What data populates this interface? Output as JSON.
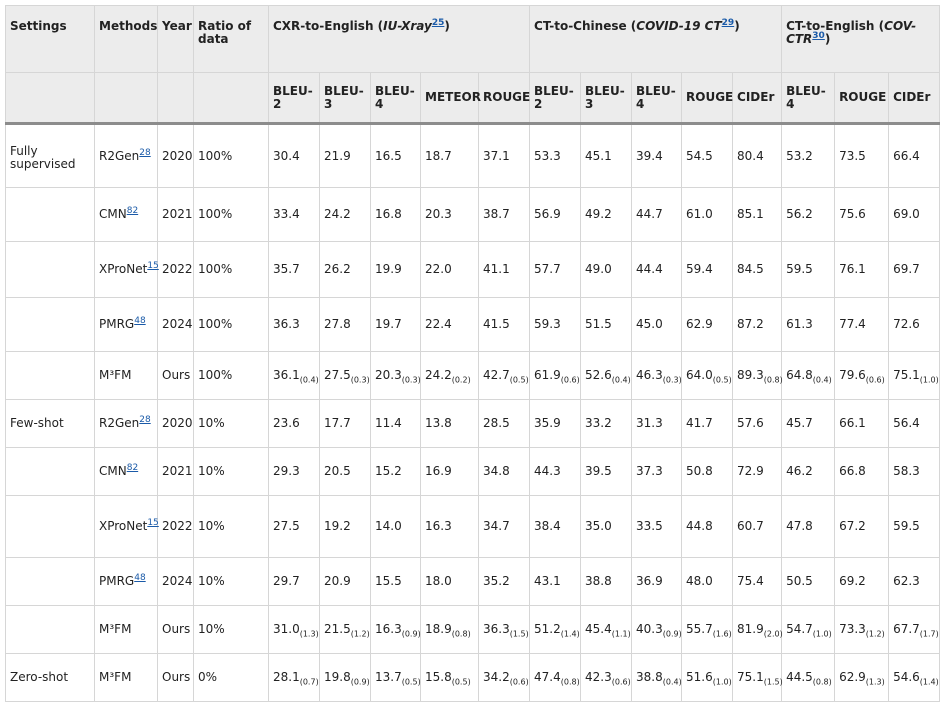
{
  "header": {
    "settings": "Settings",
    "methods": "Methods",
    "year": "Year",
    "ratio": "Ratio of data",
    "groups": [
      {
        "prefix": "CXR-to-English (",
        "dataset": "IU-Xray",
        "ref": "25",
        "suffix": ")"
      },
      {
        "prefix": "CT-to-Chinese (",
        "dataset": "COVID-19 CT",
        "ref": "29",
        "suffix": ")"
      },
      {
        "prefix": "CT-to-English (",
        "dataset": "COV-CTR",
        "ref": "30",
        "suffix": ")"
      }
    ],
    "metrics": [
      "BLEU-2",
      "BLEU-3",
      "BLEU-4",
      "METEOR",
      "ROUGE",
      "BLEU-2",
      "BLEU-3",
      "BLEU-4",
      "ROUGE",
      "CIDEr",
      "BLEU-4",
      "ROUGE",
      "CIDEr"
    ]
  },
  "rows": [
    {
      "setting": "Fully supervised",
      "method": "R2Gen",
      "ref": "28",
      "year": "2020",
      "ratio": "100%",
      "cells": [
        {
          "v": "30.4"
        },
        {
          "v": "21.9"
        },
        {
          "v": "16.5"
        },
        {
          "v": "18.7"
        },
        {
          "v": "37.1"
        },
        {
          "v": "53.3"
        },
        {
          "v": "45.1"
        },
        {
          "v": "39.4"
        },
        {
          "v": "54.5"
        },
        {
          "v": "80.4"
        },
        {
          "v": "53.2"
        },
        {
          "v": "73.5"
        },
        {
          "v": "66.4"
        }
      ]
    },
    {
      "setting": "",
      "method": "CMN",
      "ref": "82",
      "year": "2021",
      "ratio": "100%",
      "cells": [
        {
          "v": "33.4"
        },
        {
          "v": "24.2"
        },
        {
          "v": "16.8"
        },
        {
          "v": "20.3"
        },
        {
          "v": "38.7"
        },
        {
          "v": "56.9"
        },
        {
          "v": "49.2"
        },
        {
          "v": "44.7"
        },
        {
          "v": "61.0"
        },
        {
          "v": "85.1"
        },
        {
          "v": "56.2"
        },
        {
          "v": "75.6"
        },
        {
          "v": "69.0"
        }
      ]
    },
    {
      "setting": "",
      "method": "XProNet",
      "ref": "15",
      "year": "2022",
      "ratio": "100%",
      "cells": [
        {
          "v": "35.7"
        },
        {
          "v": "26.2"
        },
        {
          "v": "19.9"
        },
        {
          "v": "22.0"
        },
        {
          "v": "41.1"
        },
        {
          "v": "57.7"
        },
        {
          "v": "49.0"
        },
        {
          "v": "44.4"
        },
        {
          "v": "59.4"
        },
        {
          "v": "84.5"
        },
        {
          "v": "59.5"
        },
        {
          "v": "76.1"
        },
        {
          "v": "69.7"
        }
      ]
    },
    {
      "setting": "",
      "method": "PMRG",
      "ref": "48",
      "year": "2024",
      "ratio": "100%",
      "cells": [
        {
          "v": "36.3"
        },
        {
          "v": "27.8"
        },
        {
          "v": "19.7"
        },
        {
          "v": "22.4"
        },
        {
          "v": "41.5"
        },
        {
          "v": "59.3"
        },
        {
          "v": "51.5"
        },
        {
          "v": "45.0"
        },
        {
          "v": "62.9"
        },
        {
          "v": "87.2"
        },
        {
          "v": "61.3"
        },
        {
          "v": "77.4"
        },
        {
          "v": "72.6"
        }
      ]
    },
    {
      "setting": "",
      "method": "M³FM",
      "ref": "",
      "year": "Ours",
      "ratio": "100%",
      "cells": [
        {
          "v": "36.1",
          "s": "(0.4)"
        },
        {
          "v": "27.5",
          "s": "(0.3)"
        },
        {
          "v": "20.3",
          "s": "(0.3)"
        },
        {
          "v": "24.2",
          "s": "(0.2)"
        },
        {
          "v": "42.7",
          "s": "(0.5)"
        },
        {
          "v": "61.9",
          "s": "(0.6)"
        },
        {
          "v": "52.6",
          "s": "(0.4)"
        },
        {
          "v": "46.3",
          "s": "(0.3)"
        },
        {
          "v": "64.0",
          "s": "(0.5)"
        },
        {
          "v": "89.3",
          "s": "(0.8)"
        },
        {
          "v": "64.8",
          "s": "(0.4)"
        },
        {
          "v": "79.6",
          "s": "(0.6)"
        },
        {
          "v": "75.1",
          "s": "(1.0)"
        }
      ]
    },
    {
      "setting": "Few-shot",
      "method": "R2Gen",
      "ref": "28",
      "year": "2020",
      "ratio": "10%",
      "cells": [
        {
          "v": "23.6"
        },
        {
          "v": "17.7"
        },
        {
          "v": "11.4"
        },
        {
          "v": "13.8"
        },
        {
          "v": "28.5"
        },
        {
          "v": "35.9"
        },
        {
          "v": "33.2"
        },
        {
          "v": "31.3"
        },
        {
          "v": "41.7"
        },
        {
          "v": "57.6"
        },
        {
          "v": "45.7"
        },
        {
          "v": "66.1"
        },
        {
          "v": "56.4"
        }
      ]
    },
    {
      "setting": "",
      "method": "CMN",
      "ref": "82",
      "year": "2021",
      "ratio": "10%",
      "cells": [
        {
          "v": "29.3"
        },
        {
          "v": "20.5"
        },
        {
          "v": "15.2"
        },
        {
          "v": "16.9"
        },
        {
          "v": "34.8"
        },
        {
          "v": "44.3"
        },
        {
          "v": "39.5"
        },
        {
          "v": "37.3"
        },
        {
          "v": "50.8"
        },
        {
          "v": "72.9"
        },
        {
          "v": "46.2"
        },
        {
          "v": "66.8"
        },
        {
          "v": "58.3"
        }
      ]
    },
    {
      "setting": "",
      "method": "XProNet",
      "ref": "15",
      "year": "2022",
      "ratio": "10%",
      "cells": [
        {
          "v": "27.5"
        },
        {
          "v": "19.2"
        },
        {
          "v": "14.0"
        },
        {
          "v": "16.3"
        },
        {
          "v": "34.7"
        },
        {
          "v": "38.4"
        },
        {
          "v": "35.0"
        },
        {
          "v": "33.5"
        },
        {
          "v": "44.8"
        },
        {
          "v": "60.7"
        },
        {
          "v": "47.8"
        },
        {
          "v": "67.2"
        },
        {
          "v": "59.5"
        }
      ]
    },
    {
      "setting": "",
      "method": "PMRG",
      "ref": "48",
      "year": "2024",
      "ratio": "10%",
      "cells": [
        {
          "v": "29.7"
        },
        {
          "v": "20.9"
        },
        {
          "v": "15.5"
        },
        {
          "v": "18.0"
        },
        {
          "v": "35.2"
        },
        {
          "v": "43.1"
        },
        {
          "v": "38.8"
        },
        {
          "v": "36.9"
        },
        {
          "v": "48.0"
        },
        {
          "v": "75.4"
        },
        {
          "v": "50.5"
        },
        {
          "v": "69.2"
        },
        {
          "v": "62.3"
        }
      ]
    },
    {
      "setting": "",
      "method": "M³FM",
      "ref": "",
      "year": "Ours",
      "ratio": "10%",
      "cells": [
        {
          "v": "31.0",
          "s": "(1.3)"
        },
        {
          "v": "21.5",
          "s": "(1.2)"
        },
        {
          "v": "16.3",
          "s": "(0.9)"
        },
        {
          "v": "18.9",
          "s": "(0.8)"
        },
        {
          "v": "36.3",
          "s": "(1.5)"
        },
        {
          "v": "51.2",
          "s": "(1.4)"
        },
        {
          "v": "45.4",
          "s": "(1.1)"
        },
        {
          "v": "40.3",
          "s": "(0.9)"
        },
        {
          "v": "55.7",
          "s": "(1.6)"
        },
        {
          "v": "81.9",
          "s": "(2.0)"
        },
        {
          "v": "54.7",
          "s": "(1.0)"
        },
        {
          "v": "73.3",
          "s": "(1.2)"
        },
        {
          "v": "67.7",
          "s": "(1.7)"
        }
      ]
    },
    {
      "setting": "Zero-shot",
      "method": "M³FM",
      "ref": "",
      "year": "Ours",
      "ratio": "0%",
      "cells": [
        {
          "v": "28.1",
          "s": "(0.7)"
        },
        {
          "v": "19.8",
          "s": "(0.9)"
        },
        {
          "v": "13.7",
          "s": "(0.5)"
        },
        {
          "v": "15.8",
          "s": "(0.5)"
        },
        {
          "v": "34.2",
          "s": "(0.6)"
        },
        {
          "v": "47.4",
          "s": "(0.8)"
        },
        {
          "v": "42.3",
          "s": "(0.6)"
        },
        {
          "v": "38.8",
          "s": "(0.4)"
        },
        {
          "v": "51.6",
          "s": "(1.0)"
        },
        {
          "v": "75.1",
          "s": "(1.5)"
        },
        {
          "v": "44.5",
          "s": "(0.8)"
        },
        {
          "v": "62.9",
          "s": "(1.3)"
        },
        {
          "v": "54.6",
          "s": "(1.4)"
        }
      ]
    }
  ]
}
